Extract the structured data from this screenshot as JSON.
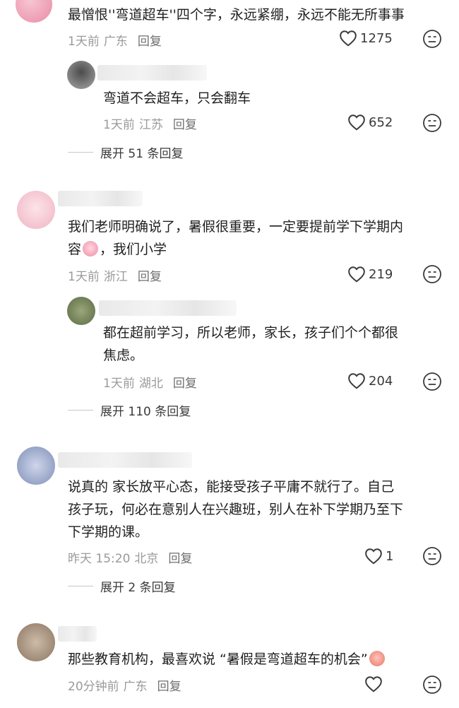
{
  "comments": [
    {
      "text": "最憎恨''弯道超车''四个字，永远紧绷，永远不能无所事事",
      "time": "1天前",
      "location": "广东",
      "reply_label": "回复",
      "likes": "1275"
    },
    {
      "text": "弯道不会超车，只会翻车",
      "time": "1天前",
      "location": "江苏",
      "reply_label": "回复",
      "likes": "652",
      "expand": "展开 51 条回复"
    },
    {
      "text_line1": "我们老师明确说了，暑假很重要，一定要提前学下学期内",
      "text_line2a": "容",
      "text_line2b": "，我们小学",
      "time": "1天前",
      "location": "浙江",
      "reply_label": "回复",
      "likes": "219"
    },
    {
      "text_line1": "都在超前学习，所以老师，家长，孩子们个个都很",
      "text_line2": "焦虑。",
      "time": "1天前",
      "location": "湖北",
      "reply_label": "回复",
      "likes": "204",
      "expand": "展开 110 条回复"
    },
    {
      "text_line1": "说真的 家长放平心态，能接受孩子平庸不就行了。自己",
      "text_line2": "孩子玩，何必在意别人在兴趣班，别人在补下学期乃至下",
      "text_line3": "下学期的课。",
      "time": "昨天 15:20",
      "location": "北京",
      "reply_label": "回复",
      "likes": "1",
      "expand": "展开 2 条回复"
    },
    {
      "text": "那些教育机构，最喜欢说 “暑假是弯道超车的机会”",
      "time": "20分钟前",
      "location": "广东",
      "reply_label": "回复",
      "likes": ""
    }
  ],
  "icons": {
    "like": "heart-outline-icon",
    "dislike": "neutral-face-icon",
    "emoji_cry": "crying-emoji-icon",
    "emoji_smug": "smug-emoji-icon"
  },
  "colors": {
    "text": "#1f1f1f",
    "meta": "#9a9a9a",
    "icon": "#3a3a3a"
  }
}
